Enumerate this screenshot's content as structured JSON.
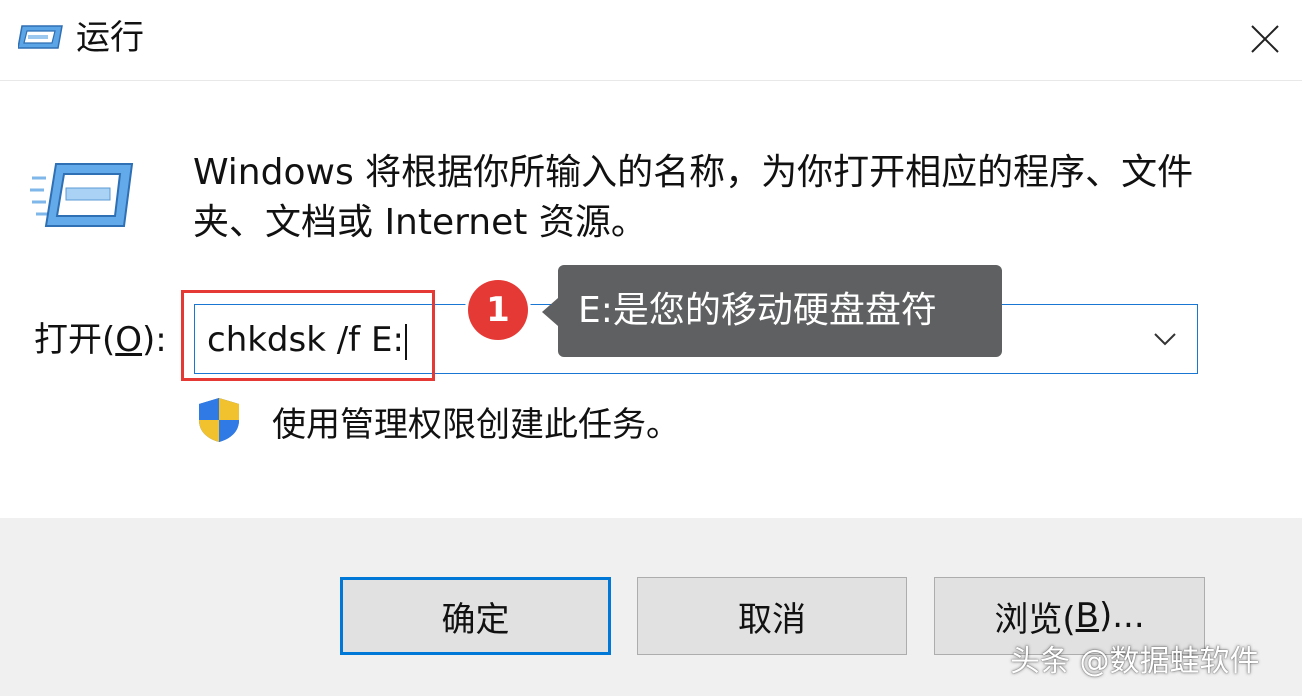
{
  "window": {
    "title": "运行",
    "close_icon": "close-icon",
    "app_icon": "run-icon"
  },
  "body": {
    "description": "Windows 将根据你所输入的名称，为你打开相应的程序、文件夹、文档或 Internet 资源。",
    "open_label_prefix": "打开(",
    "open_label_accel": "O",
    "open_label_suffix": "):",
    "command_value": "chkdsk /f E:",
    "admin_note": "使用管理权限创建此任务。",
    "shield_icon": "uac-shield-icon"
  },
  "annotation": {
    "step_number": "1",
    "tooltip": "E:是您的移动硬盘盘符",
    "highlight_color": "#e53935"
  },
  "buttons": {
    "ok_prefix": "确定",
    "cancel": "取消",
    "browse_prefix": "浏览(",
    "browse_accel": "B",
    "browse_suffix": ")..."
  },
  "watermark": "头条 @数据蛙软件",
  "colors": {
    "focus_border": "#0078d7",
    "footer_bg": "#f0f0f0",
    "tooltip_bg": "#5f6061"
  }
}
